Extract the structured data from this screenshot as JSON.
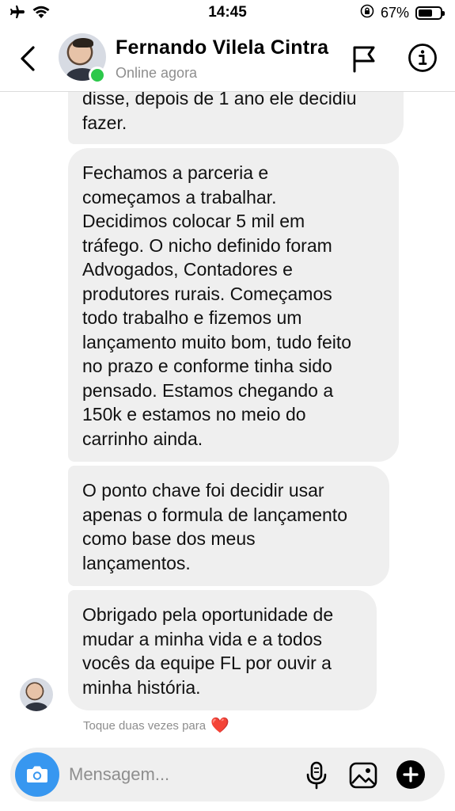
{
  "status_bar": {
    "time": "14:45",
    "battery_percent": "67%",
    "battery_level": 0.67,
    "icons": [
      "airplane-icon",
      "wifi-icon",
      "orientation-lock-icon",
      "battery-icon"
    ]
  },
  "header": {
    "contact_name": "Fernando Vilela Cintra",
    "contact_status": "Online agora",
    "online_color": "#2cc84b",
    "icons": [
      "back-icon",
      "flag-icon",
      "info-icon"
    ]
  },
  "messages": [
    {
      "text": "disse, depois de 1 ano ele decidiu\nfazer."
    },
    {
      "text": "Fechamos a parceria e\ncomeçamos a trabalhar.\nDecidimos colocar 5 mil em\ntráfego. O nicho definido foram\nAdvogados, Contadores e\nprodutores rurais. Começamos\ntodo trabalho e fizemos um\nlançamento muito bom, tudo feito\nno prazo e conforme tinha sido\npensado. Estamos chegando a\n150k e estamos no meio do\ncarrinho ainda."
    },
    {
      "text": "O ponto chave foi decidir usar\napenas o formula de lançamento\ncomo base dos meus\nlançamentos."
    },
    {
      "text": "Obrigado pela oportunidade de\nmudar a minha vida e a todos\nvocês da equipe FL por ouvir a\nminha história."
    }
  ],
  "hint": {
    "text": "Toque duas vezes para",
    "emoji": "❤️"
  },
  "composer": {
    "placeholder": "Mensagem...",
    "camera_color": "#3797f0",
    "icons": [
      "camera-icon",
      "microphone-icon",
      "gallery-icon",
      "plus-icon"
    ]
  }
}
